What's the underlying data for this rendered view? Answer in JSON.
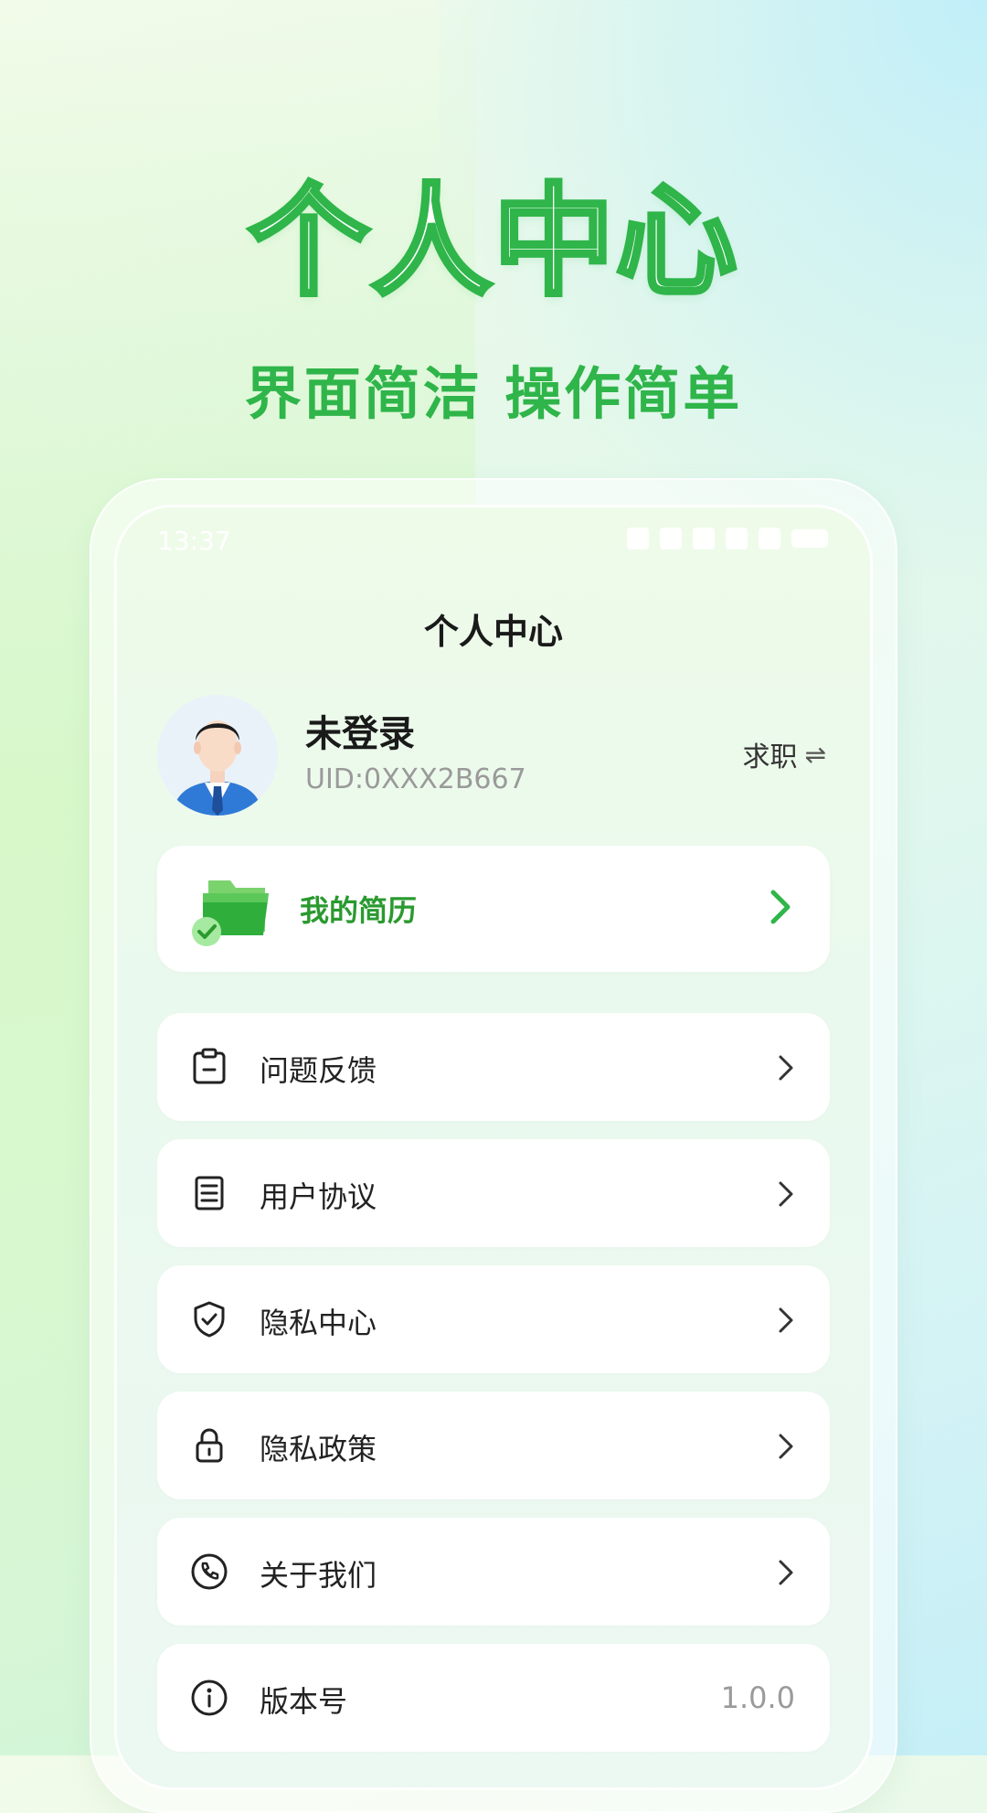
{
  "hero": {
    "title": "个人中心",
    "subtitle": "界面简洁 操作简单"
  },
  "statusbar": {
    "time": "13:37"
  },
  "page": {
    "title": "个人中心"
  },
  "profile": {
    "name": "未登录",
    "uid": "UID:0XXX2B667",
    "role_switch_label": "求职"
  },
  "resume": {
    "label": "我的简历"
  },
  "menu": {
    "items": [
      {
        "label": "问题反馈",
        "icon": "feedback-clipboard-icon"
      },
      {
        "label": "用户协议",
        "icon": "document-icon"
      },
      {
        "label": "隐私中心",
        "icon": "shield-check-icon"
      },
      {
        "label": "隐私政策",
        "icon": "lock-icon"
      },
      {
        "label": "关于我们",
        "icon": "phone-icon"
      },
      {
        "label": "版本号",
        "icon": "info-icon",
        "value": "1.0.0"
      }
    ]
  },
  "colors": {
    "brand_green": "#2fb54a",
    "resume_green": "#2a9a2f"
  }
}
